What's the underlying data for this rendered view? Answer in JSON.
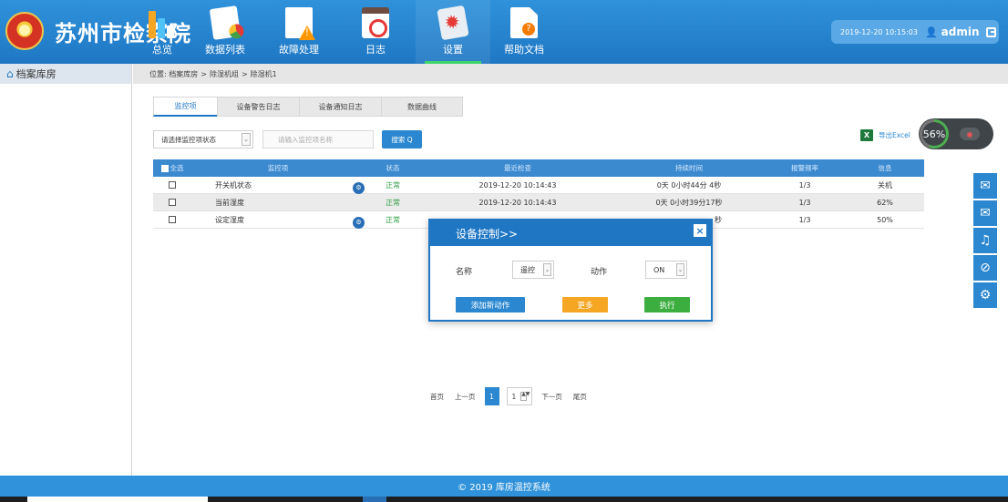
{
  "header": {
    "brand_title": "苏州市检察院",
    "nav": [
      {
        "label": "总览",
        "icon": "bar-chart-icon"
      },
      {
        "label": "数据列表",
        "icon": "data-list-icon"
      },
      {
        "label": "故障处理",
        "icon": "fault-warning-icon"
      },
      {
        "label": "日志",
        "icon": "log-calendar-icon"
      },
      {
        "label": "设置",
        "icon": "settings-gear-icon",
        "active": true
      },
      {
        "label": "帮助文档",
        "icon": "help-document-icon"
      }
    ],
    "datetime": "2019-12-20 10:15:03",
    "username": "admin"
  },
  "sidebar": {
    "items": [
      {
        "label": "档案库房",
        "icon": "home-icon"
      }
    ]
  },
  "breadcrumb": {
    "prefix": "位置:",
    "items": [
      "档案库房",
      "除湿机组",
      "除湿机1"
    ],
    "separator": ">"
  },
  "tabs": [
    {
      "label": "监控项",
      "active": true
    },
    {
      "label": "设备警告日志"
    },
    {
      "label": "设备通知日志"
    },
    {
      "label": "数据曲线"
    }
  ],
  "filter": {
    "status_select": "请选择监控项状态",
    "search_placeholder": "请输入监控项名称",
    "search_button": "搜索 Q"
  },
  "export": {
    "icon_text": "X",
    "label": "导出Excel"
  },
  "gauge": {
    "percent_text": "56%",
    "percent": 56
  },
  "table": {
    "headers": [
      "全选",
      "监控项",
      "状态",
      "最近检查",
      "持续时间",
      "报警频率",
      "信息"
    ],
    "rows": [
      {
        "name": "开关机状态",
        "status": "正常",
        "last_check": "2019-12-20 10:14:43",
        "duration": "0天 0小时44分 4秒",
        "freq": "1/3",
        "info": "关机",
        "has_icon": true
      },
      {
        "name": "当前湿度",
        "status": "正常",
        "last_check": "2019-12-20 10:14:43",
        "duration": "0天 0小时39分17秒",
        "freq": "1/3",
        "info": "62%",
        "has_icon": false
      },
      {
        "name": "设定湿度",
        "status": "正常",
        "last_check": "",
        "duration": "秒",
        "freq": "1/3",
        "info": "50%",
        "has_icon": true
      }
    ]
  },
  "pager": {
    "first": "首页",
    "prev": "上一页",
    "current": "1",
    "jump_value": "1",
    "next": "下一页",
    "last": "尾页"
  },
  "toolbar": {
    "tools": [
      "mail-icon",
      "mail-alt-icon",
      "bell-icon",
      "bell-off-icon",
      "gear-icon"
    ]
  },
  "modal": {
    "title": "设备控制>>",
    "close": "×",
    "name_label": "名称",
    "name_value": "遥控",
    "action_label": "动作",
    "action_value": "ON",
    "add_button": "添加新动作",
    "more_button": "更多",
    "execute_button": "执行"
  },
  "footer": {
    "text": "© 2019 库房温控系统"
  },
  "colors": {
    "primary": "#1f77c4",
    "header": "#2f92da",
    "table_head": "#3b89cf",
    "ok": "#2e9d43",
    "more": "#f5a623",
    "execute": "#3cae3f"
  }
}
